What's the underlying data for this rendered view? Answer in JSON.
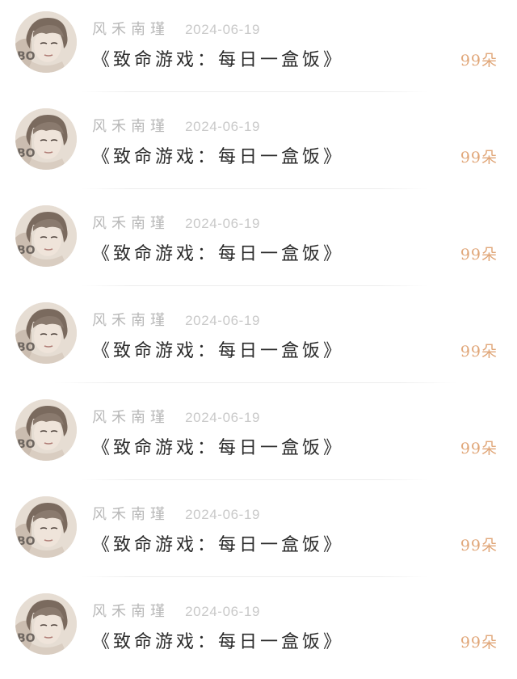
{
  "colors": {
    "background": "#ffffff",
    "author_text": "#b8b8b8",
    "date_text": "#c9c9c9",
    "title_text": "#2a2a2a",
    "amount_text": "#e0a678",
    "divider": "#ececec"
  },
  "items": [
    {
      "avatar_icon": "user-avatar-illustration",
      "author": "风禾南瑾",
      "date": "2024-06-19",
      "title": "《致命游戏：每日一盒饭》",
      "amount": "99朵"
    },
    {
      "avatar_icon": "user-avatar-illustration",
      "author": "风禾南瑾",
      "date": "2024-06-19",
      "title": "《致命游戏：每日一盒饭》",
      "amount": "99朵"
    },
    {
      "avatar_icon": "user-avatar-illustration",
      "author": "风禾南瑾",
      "date": "2024-06-19",
      "title": "《致命游戏：每日一盒饭》",
      "amount": "99朵"
    },
    {
      "avatar_icon": "user-avatar-illustration",
      "author": "风禾南瑾",
      "date": "2024-06-19",
      "title": "《致命游戏：每日一盒饭》",
      "amount": "99朵"
    },
    {
      "avatar_icon": "user-avatar-illustration",
      "author": "风禾南瑾",
      "date": "2024-06-19",
      "title": "《致命游戏：每日一盒饭》",
      "amount": "99朵"
    },
    {
      "avatar_icon": "user-avatar-illustration",
      "author": "风禾南瑾",
      "date": "2024-06-19",
      "title": "《致命游戏：每日一盒饭》",
      "amount": "99朵"
    },
    {
      "avatar_icon": "user-avatar-illustration",
      "author": "风禾南瑾",
      "date": "2024-06-19",
      "title": "《致命游戏：每日一盒饭》",
      "amount": "99朵"
    }
  ]
}
